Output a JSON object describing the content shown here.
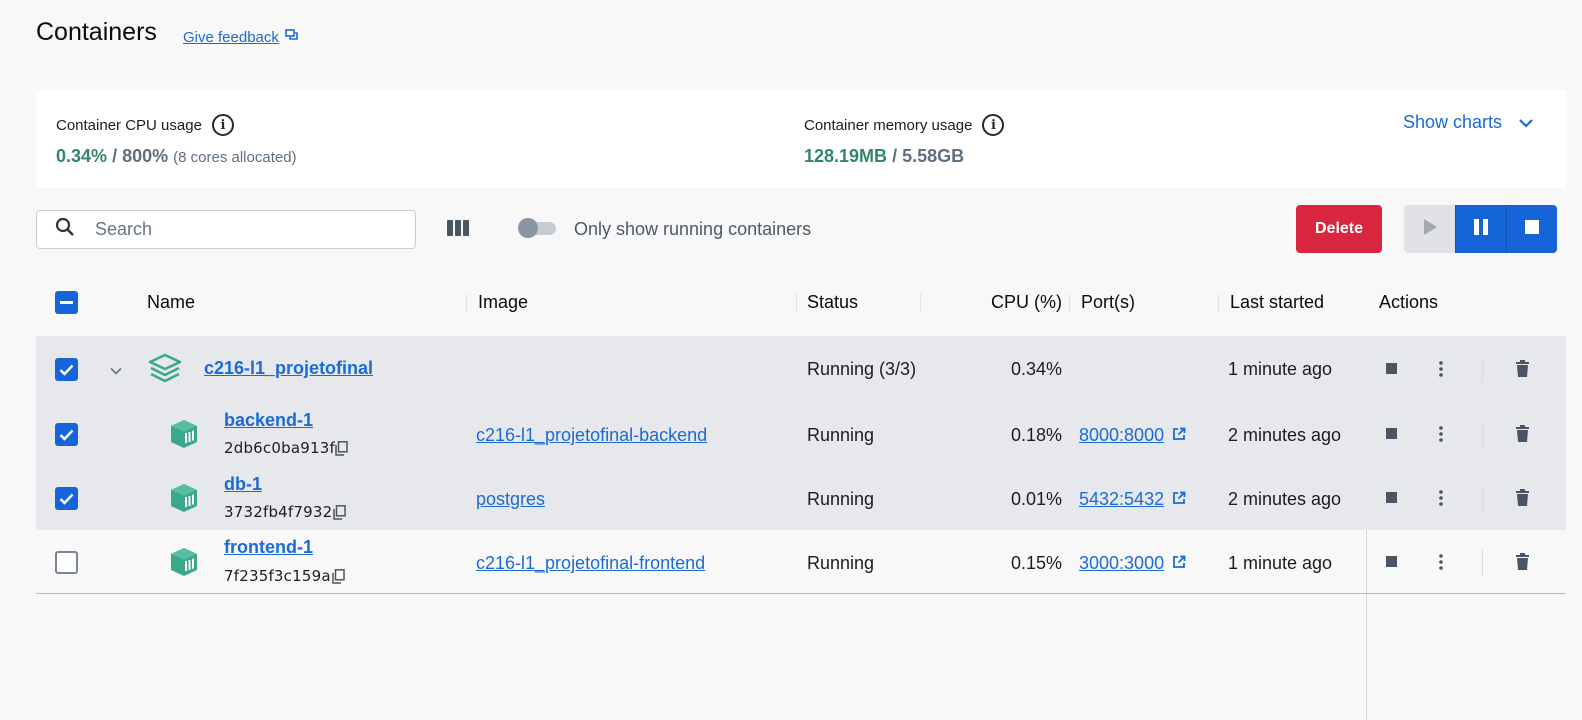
{
  "header": {
    "title": "Containers",
    "feedback_label": "Give feedback"
  },
  "usage": {
    "cpu_label": "Container CPU usage",
    "cpu_value": "0.34%",
    "cpu_sep": "/",
    "cpu_total": "800%",
    "cpu_note": "(8 cores allocated)",
    "mem_label": "Container memory usage",
    "mem_value": "128.19MB",
    "mem_sep": "/",
    "mem_total": "5.58GB",
    "show_charts_label": "Show charts"
  },
  "toolbar": {
    "search_placeholder": "Search",
    "toggle_label": "Only show running containers",
    "toggle_on": false,
    "delete_label": "Delete"
  },
  "table": {
    "headers": {
      "name": "Name",
      "image": "Image",
      "status": "Status",
      "cpu": "CPU (%)",
      "ports": "Port(s)",
      "last_started": "Last started",
      "actions": "Actions"
    },
    "group": {
      "name": "c216-l1_projetofinal",
      "status": "Running (3/3)",
      "cpu": "0.34%",
      "last_started": "1 minute ago",
      "checked": true
    },
    "rows": [
      {
        "name": "backend-1",
        "id": "2db6c0ba913f",
        "image": "c216-l1_projetofinal-backend",
        "status": "Running",
        "cpu": "0.18%",
        "port": "8000:8000",
        "last_started": "2 minutes ago",
        "checked": true
      },
      {
        "name": "db-1",
        "id": "3732fb4f7932",
        "image": "postgres",
        "status": "Running",
        "cpu": "0.01%",
        "port": "5432:5432",
        "last_started": "2 minutes ago",
        "checked": true
      },
      {
        "name": "frontend-1",
        "id": "7f235f3c159a",
        "image": "c216-l1_projetofinal-frontend",
        "status": "Running",
        "cpu": "0.15%",
        "port": "3000:3000",
        "last_started": "1 minute ago",
        "checked": false
      }
    ]
  },
  "colors": {
    "accent": "#1565d8",
    "link": "#1a6bd6",
    "danger": "#d7263d",
    "usage_green": "#34866b",
    "container_teal": "#3aa88d"
  },
  "icons": {
    "feedback": "feedback-icon",
    "info": "info-icon",
    "chevron": "chevron-down-icon",
    "search": "search-icon",
    "columns": "columns-icon",
    "play": "play-icon",
    "pause": "pause-icon",
    "stop": "stop-icon",
    "stack": "stack-icon",
    "container": "container-icon",
    "copy": "copy-icon",
    "external": "external-link-icon",
    "more": "more-vertical-icon",
    "trash": "trash-icon"
  }
}
